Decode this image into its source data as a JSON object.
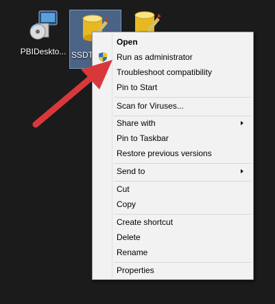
{
  "desktop": {
    "icons": [
      {
        "label": "PBIDeskto...",
        "icon": "installer-disc-icon"
      },
      {
        "label": "SSDTS",
        "icon": "database-pencil-icon"
      },
      {
        "label": "",
        "icon": "database-pencil-icon"
      }
    ]
  },
  "context_menu": {
    "items": [
      {
        "label": "Open"
      },
      {
        "label": "Run as administrator",
        "icon": "uac-shield-icon"
      },
      {
        "label": "Troubleshoot compatibility"
      },
      {
        "label": "Pin to Start"
      },
      {
        "label": "Scan for Viruses..."
      },
      {
        "label": "Share with"
      },
      {
        "label": "Pin to Taskbar"
      },
      {
        "label": "Restore previous versions"
      },
      {
        "label": "Send to"
      },
      {
        "label": "Cut"
      },
      {
        "label": "Copy"
      },
      {
        "label": "Create shortcut"
      },
      {
        "label": "Delete"
      },
      {
        "label": "Rename"
      },
      {
        "label": "Properties"
      }
    ]
  },
  "colors": {
    "callout_arrow": "#d9383a",
    "selection": "#4b6486"
  }
}
